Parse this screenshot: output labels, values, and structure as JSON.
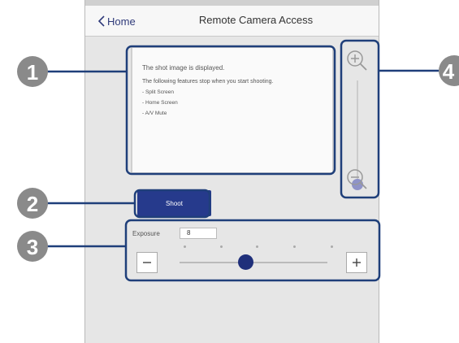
{
  "header": {
    "back_label": "Home",
    "title": "Remote Camera Access"
  },
  "preview": {
    "line1": "The shot image is displayed.",
    "line2": "The following features stop when you start shooting.",
    "bullets": [
      "-  Split Screen",
      "-  Home Screen",
      "-  A/V Mute"
    ]
  },
  "zoom": {
    "in_icon": "zoom-in-icon",
    "out_icon": "zoom-out-icon",
    "level": 0
  },
  "shoot": {
    "label": "Shoot"
  },
  "exposure": {
    "label": "Exposure",
    "value": "8",
    "min": 0,
    "max": 16
  },
  "callouts": [
    "1",
    "2",
    "3",
    "4"
  ],
  "colors": {
    "callout_fill": "#8a8a8a",
    "highlight": "#1f3f7a",
    "accent": "#263a8c",
    "knob": "#8f93c8"
  }
}
